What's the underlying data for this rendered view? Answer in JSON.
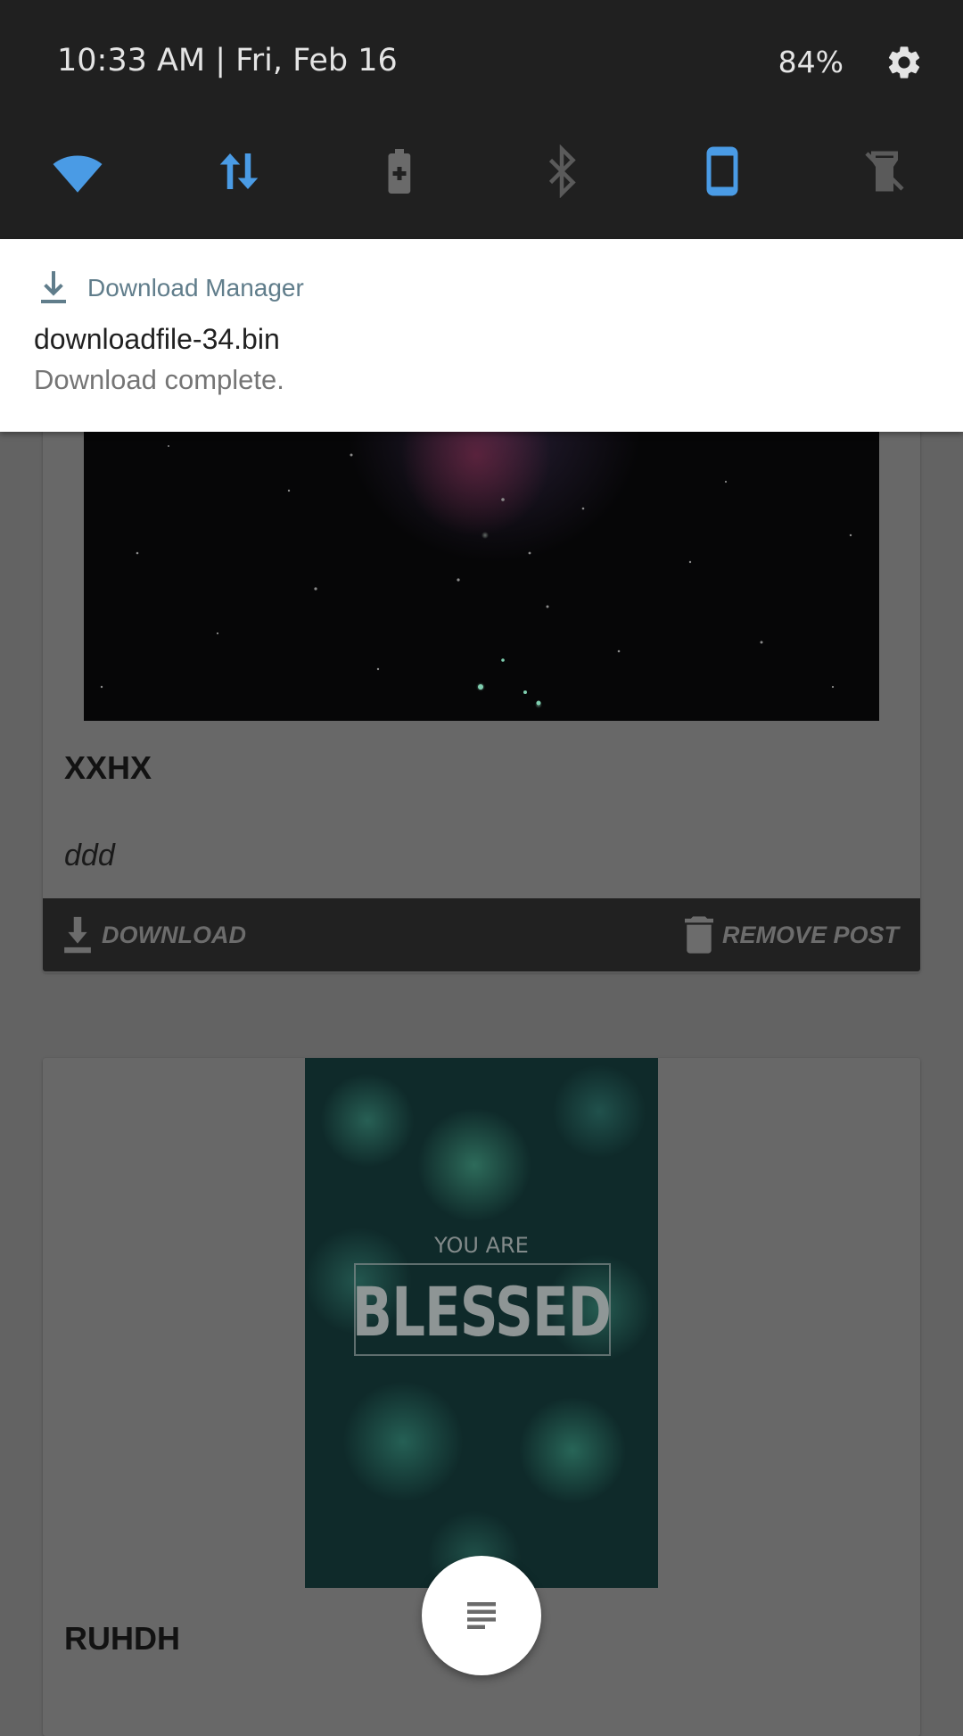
{
  "status": {
    "datetime": "10:33 AM | Fri, Feb 16",
    "battery": "84%"
  },
  "quick_tiles": [
    {
      "name": "wifi-icon",
      "active": true
    },
    {
      "name": "mobile-data-icon",
      "active": true
    },
    {
      "name": "battery-saver-icon",
      "active": false
    },
    {
      "name": "bluetooth-off-icon",
      "active": false
    },
    {
      "name": "auto-rotate-icon",
      "active": true
    },
    {
      "name": "flashlight-off-icon",
      "active": false
    }
  ],
  "notification": {
    "app_name": "Download Manager",
    "title": "downloadfile-34.bin",
    "text": "Download complete."
  },
  "feed": {
    "post1": {
      "title": "XXHX",
      "description": "ddd",
      "download_label": "DOWNLOAD",
      "remove_label": "REMOVE POST"
    },
    "post2": {
      "title": "RUHDH",
      "poster_small": "YOU ARE",
      "poster_big": "BLESSED"
    }
  },
  "colors": {
    "accent": "#4a9be5",
    "shade_bg": "#202020",
    "notif_app": "#607d8b"
  }
}
